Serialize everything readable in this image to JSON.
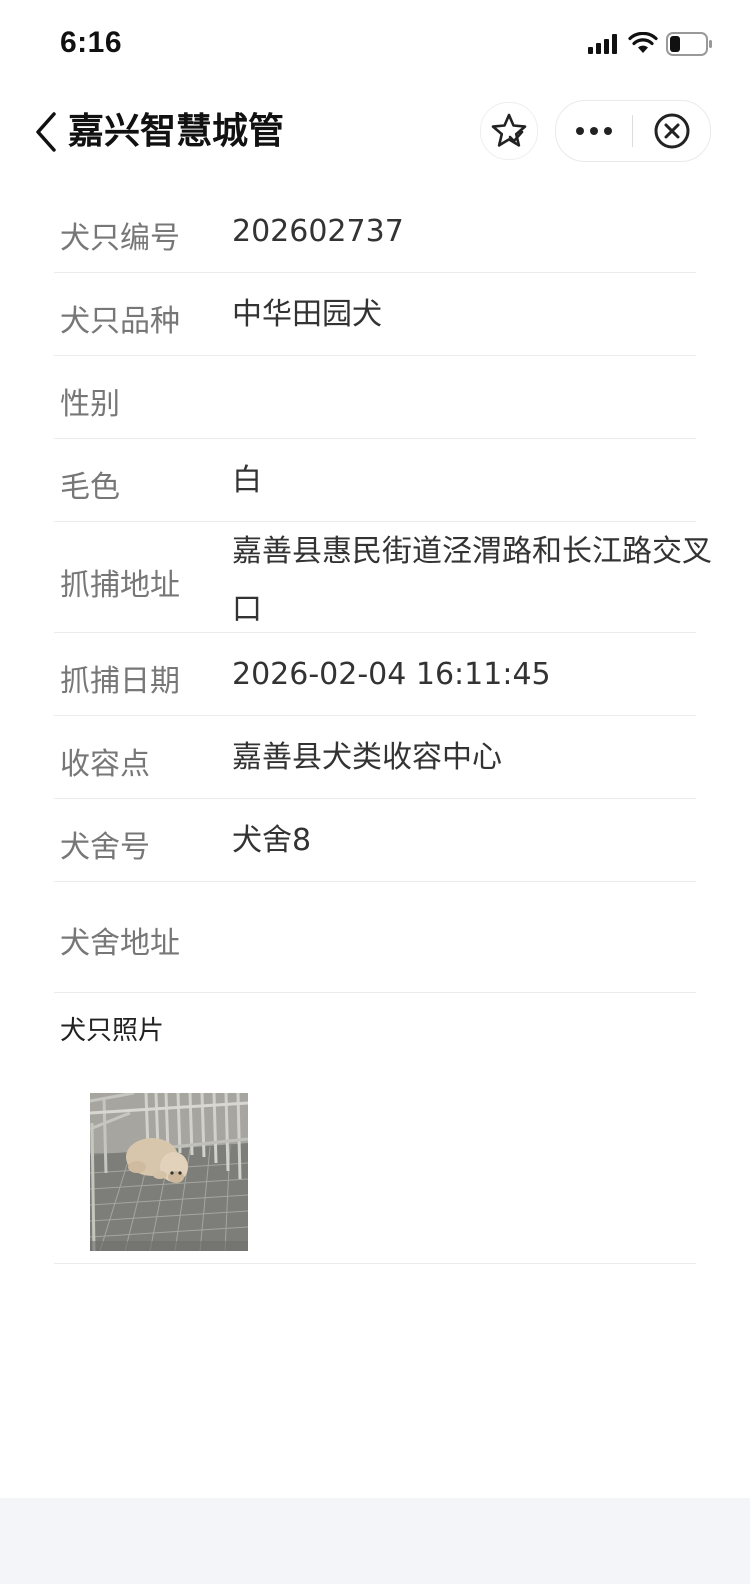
{
  "status_bar": {
    "time": "6:16"
  },
  "nav": {
    "title": "嘉兴智慧城管"
  },
  "rows": [
    {
      "label": "犬只编号",
      "value": "202602737"
    },
    {
      "label": "犬只品种",
      "value": "中华田园犬"
    },
    {
      "label": "性别",
      "value": ""
    },
    {
      "label": "毛色",
      "value": "白"
    },
    {
      "label": "抓捕地址",
      "value": "嘉善县惠民街道泾渭路和长江路交叉口"
    },
    {
      "label": "抓捕日期",
      "value": "2026-02-04 16:11:45"
    },
    {
      "label": "收容点",
      "value": "嘉善县犬类收容中心"
    },
    {
      "label": "犬舍号",
      "value": "犬舍8"
    },
    {
      "label": "犬舍地址",
      "value": ""
    }
  ],
  "photos": {
    "title": "犬只照片"
  }
}
